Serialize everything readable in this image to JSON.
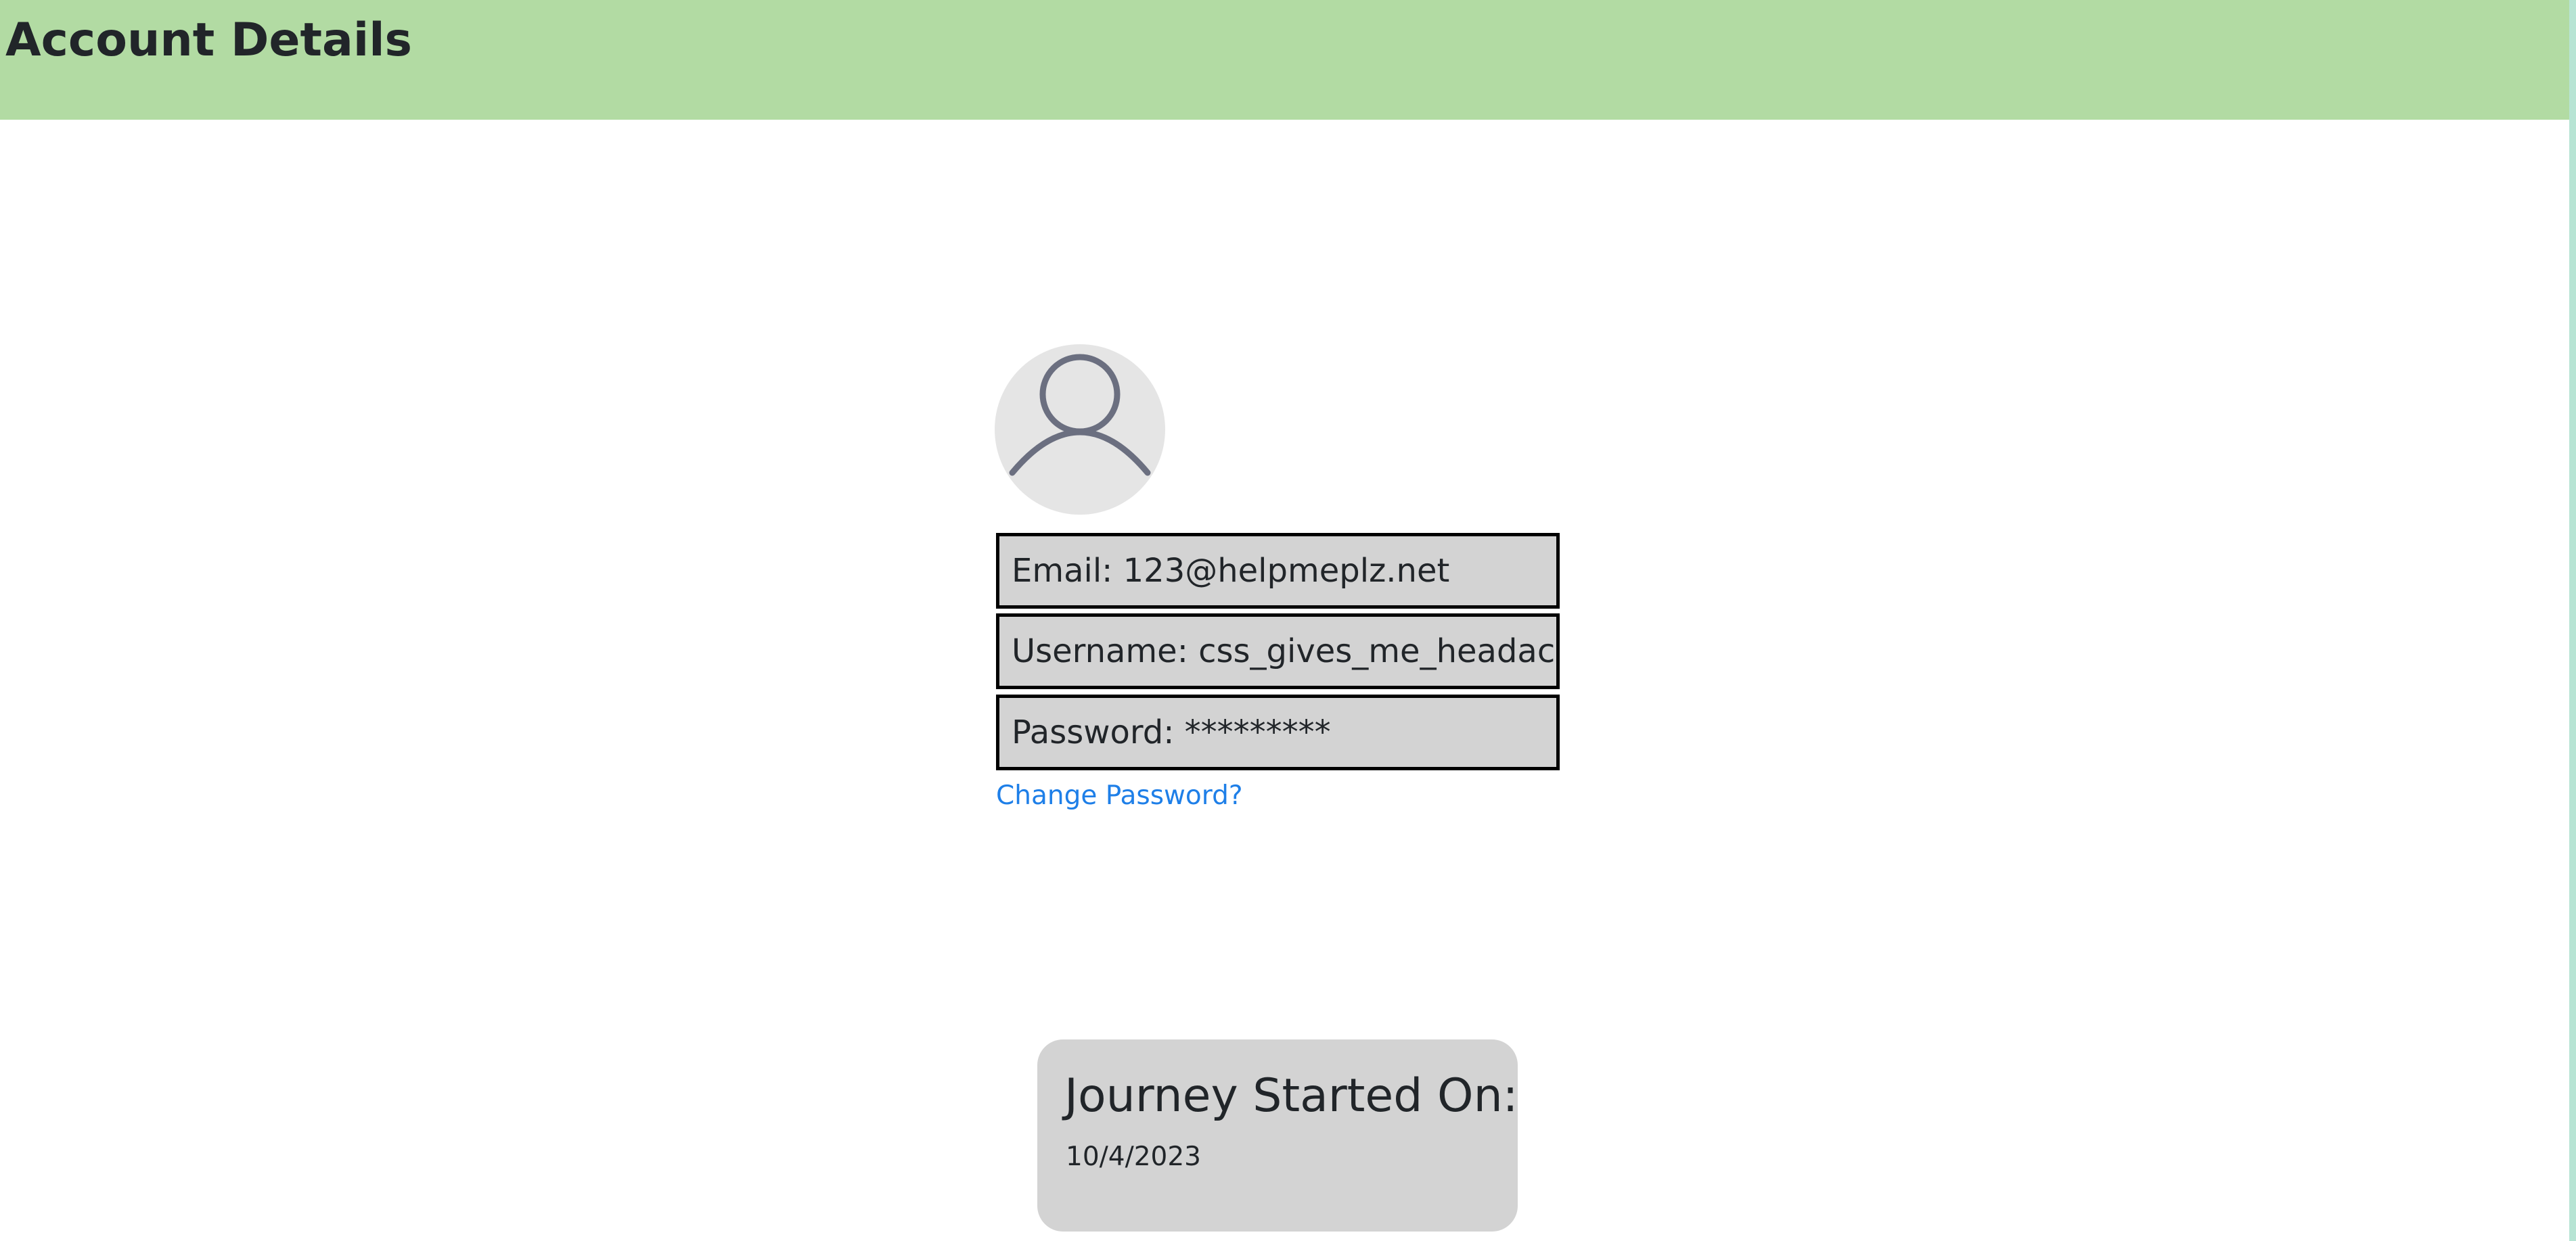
{
  "header": {
    "title": "Account Details"
  },
  "profile": {
    "avatar_icon": "user-avatar-icon",
    "email_label": "Email:",
    "email_value": "123@helpmeplz.net",
    "username_label": "Username:",
    "username_value": "css_gives_me_headaches",
    "password_label": "Password:",
    "password_value": "*********",
    "change_password_link": "Change Password?"
  },
  "journey": {
    "title": "Journey Started On:",
    "date": "10/4/2023"
  },
  "colors": {
    "header_background": "#b2dba3",
    "field_background": "#d3d3d3",
    "field_border": "#000000",
    "link": "#1e7fe8",
    "avatar_background": "#e5e5e5",
    "avatar_icon": "#6b6f80",
    "right_edge": "#b7e4d4"
  }
}
